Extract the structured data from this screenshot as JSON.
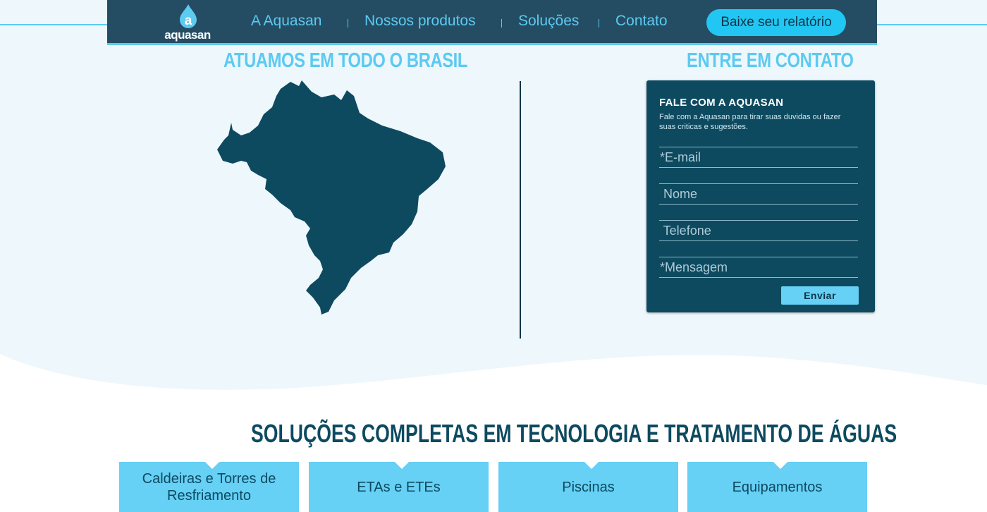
{
  "brand": {
    "logo_letter": "a",
    "logo_text": "aquasan"
  },
  "nav": {
    "links": [
      "A Aquasan",
      "Nossos produtos",
      "Soluções",
      "Contato"
    ],
    "cta_label": "Baixe seu relatório"
  },
  "coverage": {
    "title": "ATUAMOS EM TODO O BRASIL"
  },
  "contact": {
    "title": "ENTRE EM CONTATO",
    "form_title": "FALE COM A AQUASAN",
    "form_desc": "Fale com a Aquasan para tirar suas duvidas ou fazer suas criticas e sugestões.",
    "fields": [
      {
        "placeholder": "*E-mail",
        "value": ""
      },
      {
        "placeholder": " Nome",
        "value": ""
      },
      {
        "placeholder": " Telefone",
        "value": ""
      },
      {
        "placeholder": "*Mensagem",
        "value": ""
      }
    ],
    "submit_label": "Enviar"
  },
  "solutions": {
    "title": "SOLUÇÕES COMPLETAS EM TECNOLOGIA E TRATAMENTO DE ÁGUAS",
    "cards": [
      "Caldeiras e Torres de Resfriamento",
      "ETAs e ETEs",
      "Piscinas",
      "Equipamentos"
    ]
  },
  "colors": {
    "navy": "#244d63",
    "dark_teal": "#0d4a60",
    "accent_cyan": "#5ccaf1",
    "cta_blue": "#22c6f2",
    "card_blue": "#66d0f5",
    "page_bg": "#eef7fc"
  }
}
